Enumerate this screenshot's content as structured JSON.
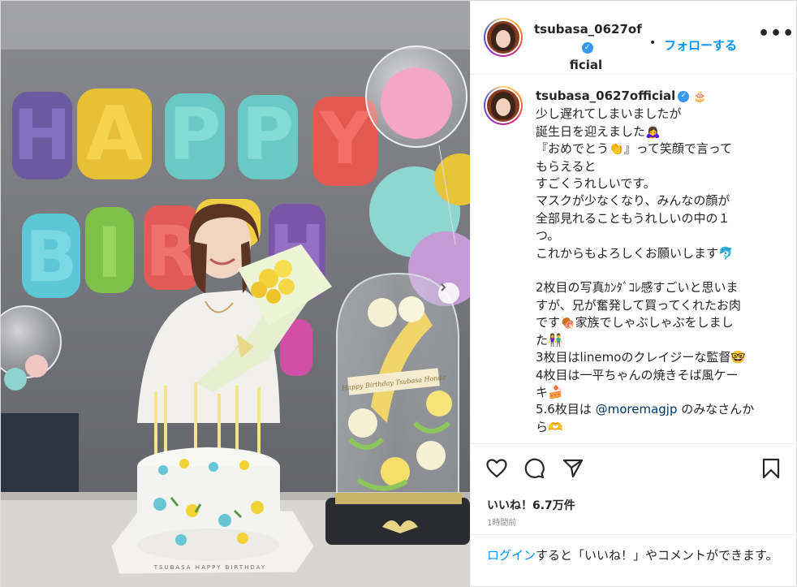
{
  "post": {
    "username": "tsubasa_0627official",
    "username_line1": "tsubasa_0627of",
    "username_line2": "ficial",
    "separator": "•",
    "follow_label": "フォローする",
    "more_label": "•••",
    "icons": {
      "verified": "verified-badge-icon",
      "more": "more-options-icon",
      "next": "chevron-right-icon",
      "like": "heart-icon",
      "comment": "comment-icon",
      "share": "send-icon",
      "save": "bookmark-icon"
    }
  },
  "photo": {
    "balloon_letters_top": [
      "H",
      "A",
      "P",
      "P",
      "Y"
    ],
    "balloon_letters_bottom": [
      "B",
      "I",
      "R",
      "T",
      "H"
    ],
    "cake_plate_text": "TSUBASA   HAPPY BIRTHDAY",
    "card_text": "Happy Birthday Tsubasa Honda"
  },
  "caption": {
    "username": "tsubasa_0627official",
    "lines": [
      "少し遅れてしまいましたが",
      "誕生日を迎えました🙇‍♀️",
      "『おめでとう👏』って笑顔で言って",
      "もらえると",
      "すごくうれしいです。",
      "マスクが少なくなり、みんなの顔が",
      "全部見れることもうれしいの中の１",
      "つ。",
      "これからもよろしくお願いします🐬",
      "",
      "2枚目の写真ｶﾝﾀﾞｺﾚ感すごいと思いま",
      "すが、兄が奮発して買ってくれたお肉",
      "です🍖家族でしゃぶしゃぶをしまし",
      "た👫",
      "3枚目はlinemoのクレイジーな監督🤓",
      "4枚目は一平ちゃんの焼きそば風ケー",
      "キ🍰"
    ],
    "last_prefix": "5.6枚目は ",
    "mention": "@moremagjp",
    "last_suffix": " のみなさんか",
    "final_line": "ら🫶"
  },
  "footer": {
    "likes": "いいね！6.7万件",
    "time": "1時間前",
    "login_link": "ログイン",
    "login_text_rest": "すると「いいね！」やコメントができます。"
  },
  "colors": {
    "accent": "#0095f6",
    "verified": "#3897f0",
    "mention": "#00376b",
    "muted": "#8e8e8e"
  }
}
